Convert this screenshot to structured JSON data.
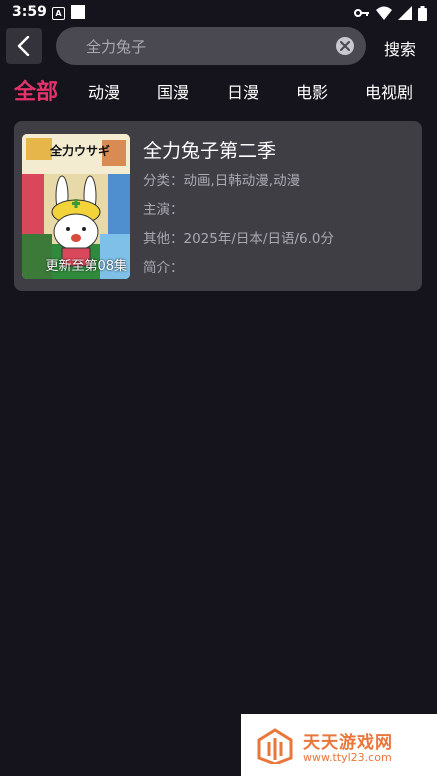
{
  "status_bar": {
    "time": "3:59",
    "a_badge": "A"
  },
  "header": {
    "search_value": "全力兔子",
    "search_button": "搜索"
  },
  "tabs": [
    "全部",
    "动漫",
    "国漫",
    "日漫",
    "电影",
    "电视剧"
  ],
  "active_tab": 0,
  "result": {
    "title": "全力兔子第二季",
    "category": "分类：动画,日韩动漫,动漫",
    "cast": "主演：",
    "other": "其他：2025年/日本/日语/6.0分",
    "intro": "简介：",
    "update_badge": "更新至第08集",
    "poster_logo_text": "全力ウサギ"
  },
  "watermark": {
    "title": "天天游戏网",
    "url": "www.ttyl23.com"
  },
  "colors": {
    "background": "#15141c",
    "accent": "#e2336a",
    "card": "#3f3e45",
    "watermark": "#e9763a"
  }
}
